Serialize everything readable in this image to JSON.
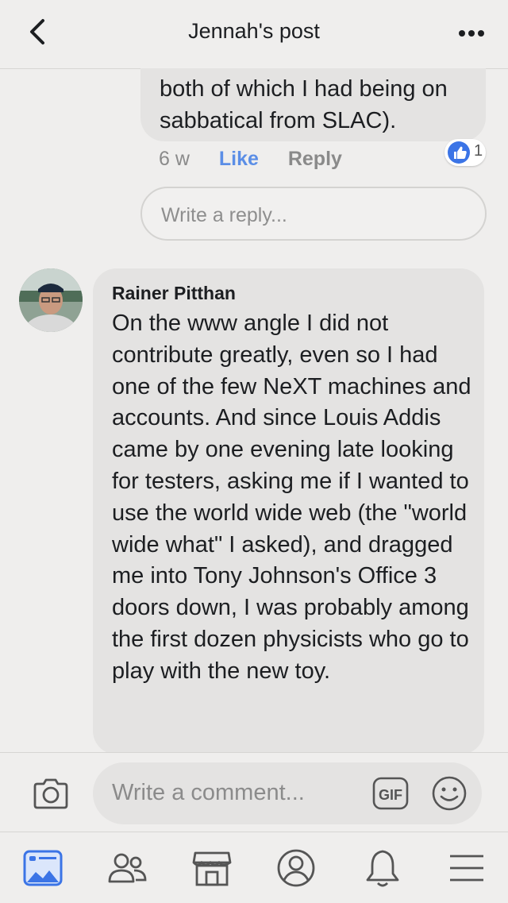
{
  "header": {
    "title": "Jennah's post",
    "back_icon": "chevron-left-icon",
    "more_icon": "more-horizontal-icon"
  },
  "previous_comment": {
    "text": "both of which I had being on sabbatical from SLAC).",
    "time": "6 w",
    "like_label": "Like",
    "reply_label": "Reply",
    "reaction_count": "1",
    "reaction_icon": "thumbs-up-icon",
    "reply_placeholder": "Write a reply..."
  },
  "comment": {
    "author": "Rainer Pitthan",
    "text": "On the www  angle I did not contribute greatly, even so I had one of the few NeXT machines and accounts. And since Louis Addis came by one evening late looking for testers, asking me if I wanted to use the world wide web (the \"world wide what\" I asked), and dragged me into Tony Johnson's Office 3 doors down, I was probably among the first dozen physicists who go to play with the new toy."
  },
  "composer": {
    "placeholder": "Write a comment...",
    "camera_icon": "camera-icon",
    "gif_label": "GIF",
    "emoji_icon": "smiley-icon"
  },
  "nav": {
    "items": [
      "news-feed-icon",
      "friends-icon",
      "marketplace-icon",
      "profile-icon",
      "notifications-icon",
      "menu-icon"
    ]
  },
  "colors": {
    "background": "#efeeed",
    "bubble": "#e4e3e2",
    "accent": "#5b8ee6",
    "like_blue": "#3b74e6"
  }
}
